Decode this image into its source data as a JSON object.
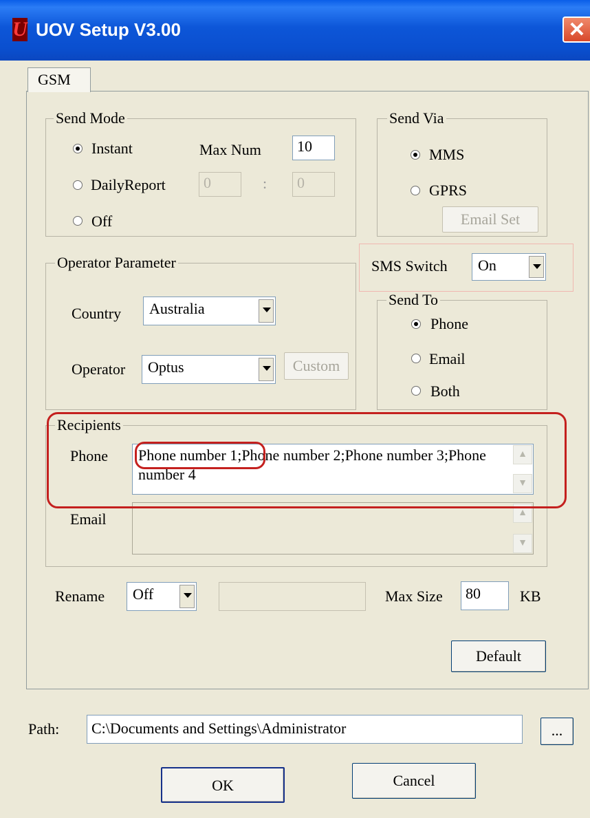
{
  "window": {
    "title": "UOV Setup V3.00",
    "logo_letter": "U",
    "close_glyph": "✕"
  },
  "tab": {
    "label": "GSM"
  },
  "send_mode": {
    "legend": "Send Mode",
    "instant_label": "Instant",
    "daily_report_label": "DailyReport",
    "off_label": "Off",
    "selected": "Instant",
    "max_num_label": "Max Num",
    "max_num_value": "10",
    "hour_value": "0",
    "separator": ":",
    "minute_value": "0"
  },
  "send_via": {
    "legend": "Send Via",
    "mms_label": "MMS",
    "gprs_label": "GPRS",
    "selected": "MMS",
    "email_set_label": "Email Set"
  },
  "sms_switch": {
    "label": "SMS Switch",
    "value": "On"
  },
  "operator_parameter": {
    "legend": "Operator Parameter",
    "country_label": "Country",
    "country_value": "Australia",
    "operator_label": "Operator",
    "operator_value": "Optus",
    "custom_label": "Custom"
  },
  "send_to": {
    "legend": "Send To",
    "phone_label": "Phone",
    "email_label": "Email",
    "both_label": "Both",
    "selected": "Phone"
  },
  "recipients": {
    "legend": "Recipients",
    "phone_label": "Phone",
    "phone_value": "Phone number 1;Phone number 2;Phone number 3;Phone number 4",
    "email_label": "Email",
    "email_value": ""
  },
  "rename": {
    "label": "Rename",
    "value": "Off",
    "text_value": ""
  },
  "max_size": {
    "label": "Max Size",
    "value": "80",
    "unit": "KB"
  },
  "default_button": "Default",
  "path": {
    "label": "Path:",
    "value": "C:\\Documents and Settings\\Administrator",
    "browse_label": "..."
  },
  "ok_button": "OK",
  "cancel_button": "Cancel",
  "colors": {
    "title_bar": "#0a5ee8",
    "dialog_bg": "#ece9d8",
    "annotation": "#c4201e"
  }
}
